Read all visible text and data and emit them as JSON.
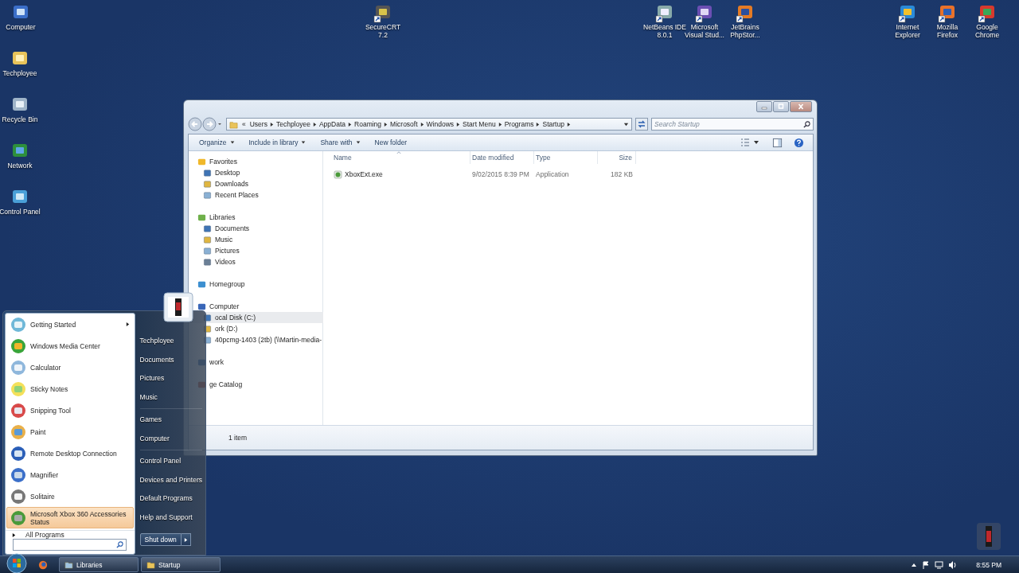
{
  "desktop_icons": [
    {
      "label_lines": [
        "Computer"
      ],
      "shortcut": false
    },
    {
      "label_lines": [
        "Techployee"
      ],
      "shortcut": false
    },
    {
      "label_lines": [
        "Recycle Bin"
      ],
      "shortcut": false
    },
    {
      "label_lines": [
        "Network"
      ],
      "shortcut": false
    },
    {
      "label_lines": [
        "Control Panel"
      ],
      "shortcut": false
    },
    {
      "label_lines": [
        "SecureCRT",
        "7.2"
      ],
      "shortcut": true
    },
    {
      "label_lines": [
        "NetBeans IDE",
        "8.0.1"
      ],
      "shortcut": true
    },
    {
      "label_lines": [
        "Microsoft",
        "Visual Stud..."
      ],
      "shortcut": true
    },
    {
      "label_lines": [
        "JetBrains",
        "PhpStor..."
      ],
      "shortcut": true
    },
    {
      "label_lines": [
        "Internet",
        "Explorer"
      ],
      "shortcut": true
    },
    {
      "label_lines": [
        "Mozilla",
        "Firefox"
      ],
      "shortcut": true
    },
    {
      "label_lines": [
        "Google",
        "Chrome"
      ],
      "shortcut": true
    }
  ],
  "explorer": {
    "overflow_mark": "«",
    "breadcrumb": [
      "Users",
      "Techployee",
      "AppData",
      "Roaming",
      "Microsoft",
      "Windows",
      "Start Menu",
      "Programs",
      "Startup"
    ],
    "search": {
      "placeholder": "Search Startup"
    },
    "toolbar": [
      {
        "label": "Organize",
        "dropdown": true
      },
      {
        "label": "Include in library",
        "dropdown": true
      },
      {
        "label": "Share with",
        "dropdown": true
      },
      {
        "label": "New folder",
        "dropdown": false
      }
    ],
    "nav": [
      {
        "label": "Favorites",
        "selected": false,
        "children": [
          {
            "label": "Desktop",
            "selected": false
          },
          {
            "label": "Downloads",
            "selected": false
          },
          {
            "label": "Recent Places",
            "selected": false
          }
        ]
      },
      {
        "label": "Libraries",
        "selected": false,
        "children": [
          {
            "label": "Documents",
            "selected": false
          },
          {
            "label": "Music",
            "selected": false
          },
          {
            "label": "Pictures",
            "selected": false
          },
          {
            "label": "Videos",
            "selected": false
          }
        ]
      },
      {
        "label": "Homegroup",
        "selected": false
      },
      {
        "label": "Computer",
        "selected": false,
        "children": [
          {
            "label": "ocal Disk (C:)",
            "selected": true
          },
          {
            "label": "ork (D:)",
            "selected": false
          },
          {
            "label": "40pcmg-1403 (2tb) (\\\\Martin-media-",
            "selected": false
          }
        ]
      },
      {
        "label": "work",
        "selected": false
      },
      {
        "label": "ge Catalog",
        "selected": false
      }
    ],
    "columns": [
      "Name",
      "Date modified",
      "Type",
      "Size"
    ],
    "rows": [
      {
        "cells": [
          "XboxExt.exe",
          "9/02/2015 8:39 PM",
          "Application",
          "182 KB"
        ]
      }
    ],
    "status": "1 item"
  },
  "start_menu": {
    "programs": [
      {
        "label": "Getting Started",
        "submenu": true,
        "selected": false
      },
      {
        "label": "Windows Media Center",
        "submenu": false,
        "selected": false
      },
      {
        "label": "Calculator",
        "submenu": false,
        "selected": false
      },
      {
        "label": "Sticky Notes",
        "submenu": false,
        "selected": false
      },
      {
        "label": "Snipping Tool",
        "submenu": false,
        "selected": false
      },
      {
        "label": "Paint",
        "submenu": false,
        "selected": false
      },
      {
        "label": "Remote Desktop Connection",
        "submenu": false,
        "selected": false
      },
      {
        "label": "Magnifier",
        "submenu": false,
        "selected": false
      },
      {
        "label": "Solitaire",
        "submenu": false,
        "selected": false
      },
      {
        "label": "Microsoft Xbox 360 Accessories Status",
        "submenu": false,
        "selected": true
      }
    ],
    "all_programs": "All Programs",
    "places": [
      {
        "items": [
          "Techployee",
          "Documents",
          "Pictures",
          "Music"
        ]
      },
      {
        "items": [
          "Games",
          "Computer"
        ]
      },
      {
        "items": [
          "Control Panel",
          "Devices and Printers",
          "Default Programs",
          "Help and Support"
        ]
      }
    ],
    "shutdown": "Shut down"
  },
  "taskbar": {
    "buttons": [
      {
        "label": "Libraries"
      },
      {
        "label": "Startup"
      }
    ],
    "time": "8:55 PM"
  }
}
